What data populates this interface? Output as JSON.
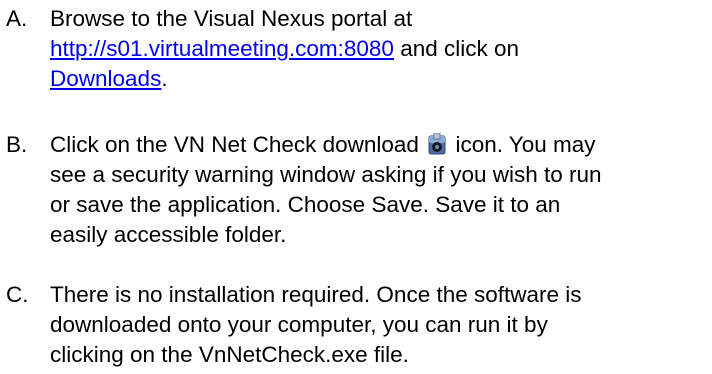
{
  "steps": [
    {
      "marker": "A.",
      "l1": "Browse to the Visual Nexus portal at",
      "link_url": "http://s01.virtualmeeting.com:8080",
      "l2_after": " and click on",
      "link_downloads": "Downloads",
      "l3_after": "."
    },
    {
      "marker": "B.",
      "l1_before": "Click on the VN Net Check download ",
      "icon": "vn-net-check-download-icon",
      "l1_after": " icon. You may",
      "l2": "see a security warning window asking if you wish to run",
      "l3": "or save the application. Choose Save.  Save it to an",
      "l4": "easily accessible folder."
    },
    {
      "marker": "C.",
      "l1": "There is no installation required. Once the software is",
      "l2": "downloaded onto your computer, you can run it by",
      "l3": "clicking on the VnNetCheck.exe file."
    }
  ]
}
